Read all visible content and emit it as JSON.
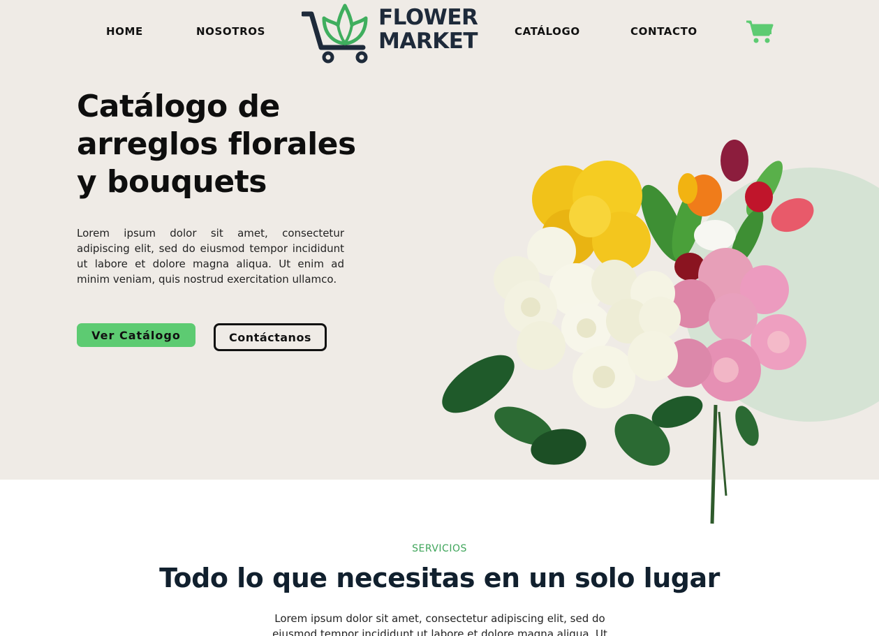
{
  "nav": {
    "items": [
      {
        "label": "HOME"
      },
      {
        "label": "NOSOTROS"
      },
      {
        "label": "CATÁLOGO"
      },
      {
        "label": "CONTACTO"
      }
    ],
    "logo": {
      "line1": "FLOWER",
      "line2": "MARKET"
    },
    "cart_icon": "shopping-cart-icon"
  },
  "hero": {
    "title": "Catálogo de arreglos florales y bouquets",
    "text": "Lorem ipsum dolor sit amet, consectetur adipiscing elit, sed do eiusmod tempor incididunt ut labore et dolore magna aliqua. Ut enim ad minim veniam, quis nostrud exercitation ullamco.",
    "primary_button": "Ver  Catálogo",
    "secondary_button": "Contáctanos"
  },
  "services": {
    "eyebrow": "SERVICIOS",
    "title": "Todo lo que necesitas en un solo lugar",
    "text": "Lorem ipsum dolor sit amet, consectetur adipiscing elit, sed do eiusmod tempor incididunt ut labore et dolore magna aliqua. Ut"
  },
  "colors": {
    "accent_green": "#5dcb72",
    "hero_background": "#efebe6",
    "dark_navy": "#1e2a3a",
    "circle_green": "#d5e3d4"
  }
}
